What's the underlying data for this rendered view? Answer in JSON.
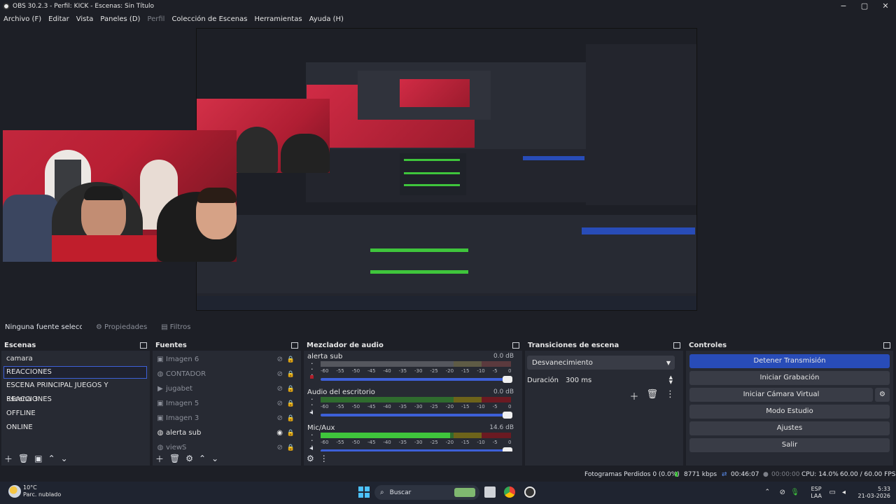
{
  "titlebar": {
    "title": "OBS 30.2.3 - Perfil: KICK - Escenas: Sin Título",
    "minimize": "−",
    "maximize": "▢",
    "close": "✕"
  },
  "menu": [
    {
      "label": "Archivo (F)"
    },
    {
      "label": "Editar"
    },
    {
      "label": "Vista"
    },
    {
      "label": "Paneles (D)"
    },
    {
      "label": "Perfil",
      "disabled": true
    },
    {
      "label": "Colección de Escenas"
    },
    {
      "label": "Herramientas"
    },
    {
      "label": "Ayuda (H)"
    }
  ],
  "sourcebar": {
    "no_source": "Ninguna fuente seleccionada",
    "properties": "Propiedades",
    "filters": "Filtros"
  },
  "scenes": {
    "title": "Escenas",
    "items": [
      "camara",
      "REACCIONES",
      "ESCENA PRINCIPAL JUEGOS Y REACCIONES",
      "Escena 3",
      "OFFLINE",
      "ONLINE"
    ],
    "selected_index": 1
  },
  "sources": {
    "title": "Fuentes",
    "items": [
      {
        "label": "Imagen 6",
        "icon": "image-icon",
        "visible": false
      },
      {
        "label": "CONTADOR",
        "icon": "globe-icon",
        "visible": false
      },
      {
        "label": "jugabet",
        "icon": "play-icon",
        "visible": false
      },
      {
        "label": "Imagen 5",
        "icon": "image-icon",
        "visible": false
      },
      {
        "label": "Imagen 3",
        "icon": "image-icon",
        "visible": false
      },
      {
        "label": "alerta sub",
        "icon": "globe-icon",
        "visible": true
      },
      {
        "label": "viewS",
        "icon": "globe-icon",
        "visible": false
      }
    ]
  },
  "mixer": {
    "title": "Mezclador de audio",
    "scale_labels": [
      "-60",
      "-55",
      "-50",
      "-45",
      "-40",
      "-35",
      "-30",
      "-25",
      "-20",
      "-15",
      "-10",
      "-5",
      "0"
    ],
    "channels": [
      {
        "name": "alerta sub",
        "db": "0.0 dB",
        "level": 0.0,
        "muted": true
      },
      {
        "name": "Audio del escritorio",
        "db": "0.0 dB",
        "level": 0.0,
        "muted": false
      },
      {
        "name": "Mic/Aux",
        "db": "14.6 dB",
        "level": 0.68,
        "muted": false
      }
    ]
  },
  "transitions": {
    "title": "Transiciones de escena",
    "selected": "Desvanecimiento",
    "duration_label": "Duración",
    "duration_value": "300 ms"
  },
  "controls": {
    "title": "Controles",
    "buttons": [
      "Detener Transmisión",
      "Iniciar Grabación",
      "Iniciar Cámara Virtual",
      "Modo Estudio",
      "Ajustes",
      "Salir"
    ]
  },
  "status": {
    "dropped": "Fotogramas Perdidos 0 (0.0%)",
    "bitrate": "8771 kbps",
    "stream_time": "00:46:07",
    "rec_time": "00:00:00",
    "cpu": "CPU: 14.0%",
    "fps": "60.00 / 60.00 FPS"
  },
  "taskbar": {
    "temp": "10°C",
    "weather": "Parc. nublado",
    "search": "Buscar",
    "lang_top": "ESP",
    "lang_bottom": "LAA",
    "time": "5:33",
    "date": "21-03-2026"
  },
  "colors": {
    "accent": "#284cb8",
    "panel": "#272a33",
    "header": "#1d1f26",
    "meter_green": "#3fc53c",
    "meter_yellow": "#a99b1e",
    "meter_red": "#b21f2a"
  }
}
